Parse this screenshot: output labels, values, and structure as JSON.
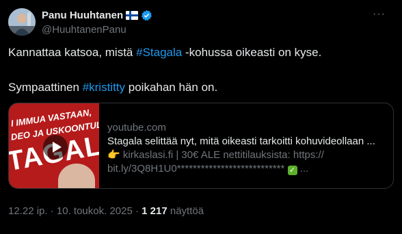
{
  "author": {
    "name": "Panu Huuhtanen",
    "handle": "@HuuhtanenPanu"
  },
  "tweet": {
    "line1_before": "Kannattaa katsoa, mistä ",
    "line1_hashtag": "#Stagala",
    "line1_after": " -kohussa oikeasti on kyse.",
    "line2_hashtag": "#kristitty",
    "line2_before": "Sympaattinen ",
    "line2_after": " poikahan hän on."
  },
  "card": {
    "domain": "youtube.com",
    "title": "Stagala selittää nyt, mitä oikeasti tarkoitti kohuvideollaan ...",
    "desc_line1": " kirkaslasi.fi | 30€ ALE nettitilauksista: https://",
    "desc_line2": "bit.ly/3Q8H1U0*************************** ",
    "desc_line2_end": " ...",
    "thumb_line1": "I IMMUA VASTAAN,",
    "thumb_line2": "DEO JA USKOONTULO!",
    "thumb_big": "TAGALA"
  },
  "meta": {
    "time": "12.22 ip.",
    "sep": " · ",
    "date": "10. toukok. 2025",
    "views_count": "1 217",
    "views_label": " näyttöä"
  },
  "colors": {
    "background": "#000000",
    "text": "#e7e9ea",
    "secondary": "#71767b",
    "link": "#1d9bf0",
    "border": "#2f3336"
  },
  "icons": [
    "finland-flag-icon",
    "verified-badge-icon",
    "more-icon",
    "play-icon"
  ]
}
